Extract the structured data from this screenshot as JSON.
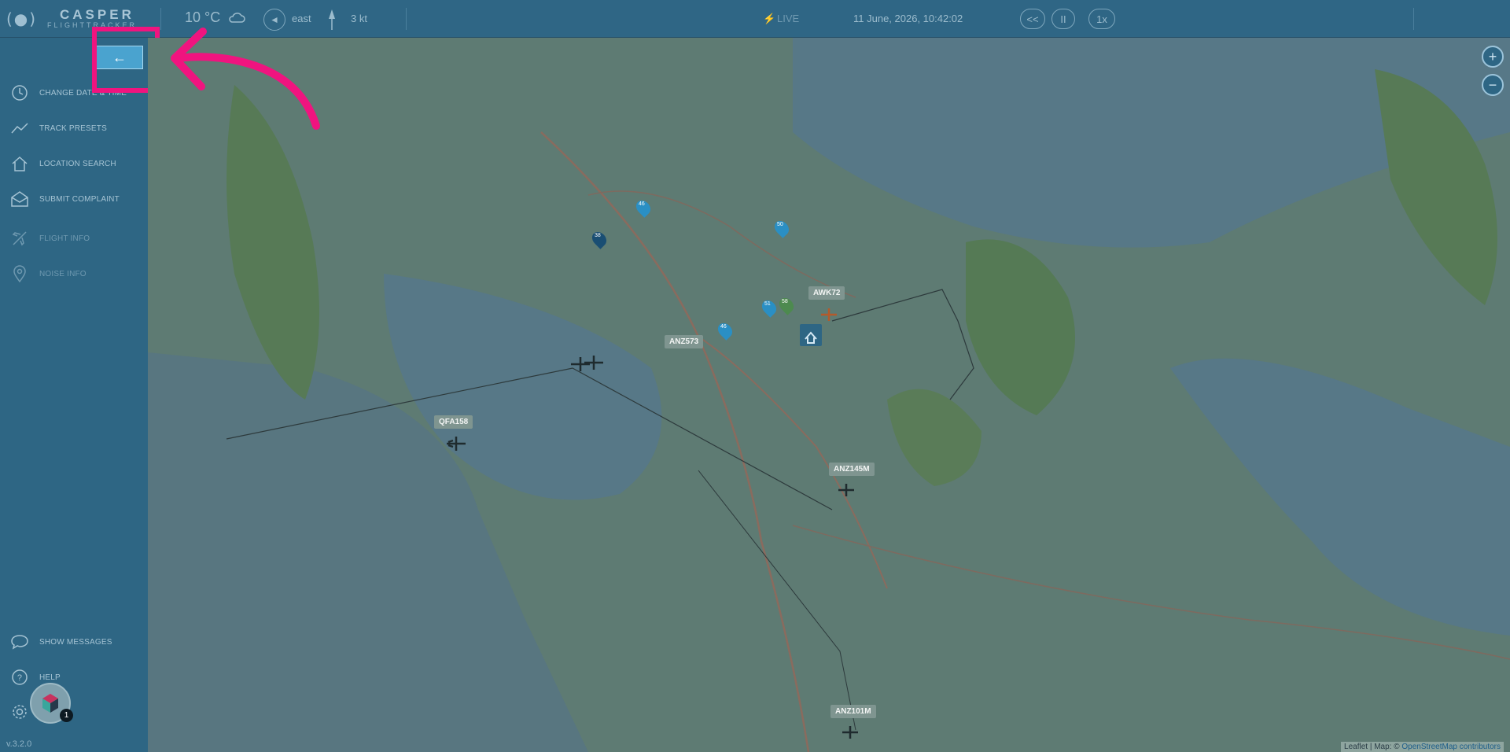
{
  "app": {
    "logo_mark": "(●)",
    "logo_title": "CASPER",
    "logo_subtitle": "FLIGHTTRACKER",
    "version": "v.3.2.0"
  },
  "topbar": {
    "temperature": "10 °C",
    "wind_direction": "east",
    "wind_speed": "3 kt",
    "live_label": "LIVE",
    "datetime": "11 June, 2026, 10:42:02",
    "rewind_label": "<<",
    "pause_label": "II",
    "speed_label": "1x"
  },
  "sidebar": {
    "collapse_icon": "←",
    "items": [
      {
        "label": "CHANGE DATE & TIME",
        "icon": "clock-icon"
      },
      {
        "label": "TRACK PRESETS",
        "icon": "chart-line-icon"
      },
      {
        "label": "LOCATION SEARCH",
        "icon": "home-icon"
      },
      {
        "label": "SUBMIT COMPLAINT",
        "icon": "envelope-icon"
      },
      {
        "label": "FLIGHT INFO",
        "icon": "plane-icon"
      },
      {
        "label": "NOISE INFO",
        "icon": "map-pin-icon"
      }
    ],
    "bottom_items": [
      {
        "label": "SHOW MESSAGES",
        "icon": "chat-icon"
      },
      {
        "label": "HELP",
        "icon": "help-icon"
      }
    ],
    "chat_badge": "1"
  },
  "map": {
    "flights": [
      {
        "callsign": "AWK72"
      },
      {
        "callsign": "ANZ573"
      },
      {
        "callsign": "QFA158"
      },
      {
        "callsign": "ANZ145M"
      },
      {
        "callsign": "ANZ101M"
      }
    ],
    "markers": [
      "46",
      "50",
      "38",
      "51",
      "58",
      "46"
    ],
    "attribution_prefix": "Leaflet | Map: ©",
    "attribution_link": "OpenStreetMap contributors"
  },
  "colors": {
    "sidebar": "#2e6684",
    "accent": "#4aa3cf",
    "highlight": "#f0147f",
    "marker": "#2a8fc4"
  }
}
